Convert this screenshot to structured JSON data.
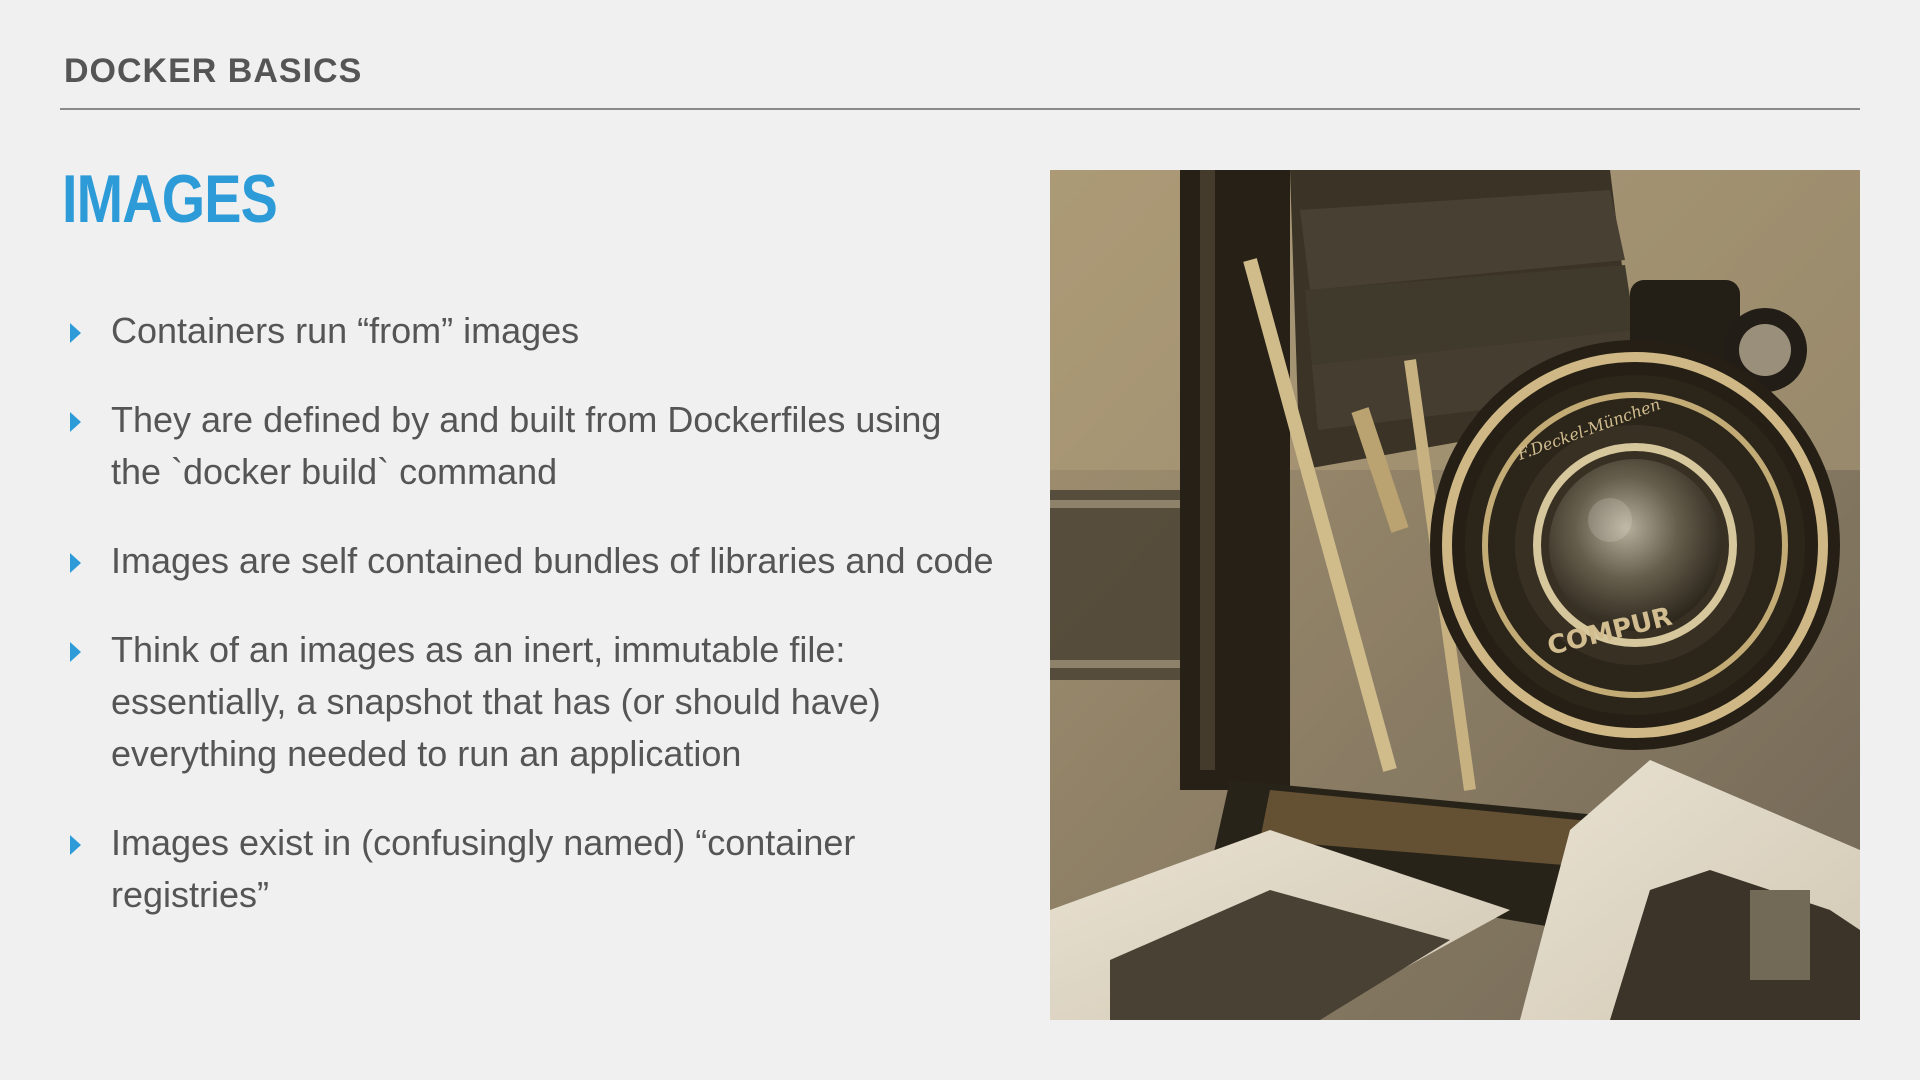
{
  "slide": {
    "section": "DOCKER BASICS",
    "title": "IMAGES",
    "bullets": [
      "Containers run “from” images",
      "They are defined by and built from Dockerfiles using the `docker build` command",
      "Images are self contained bundles of libraries and code",
      "Think of an images as an inert, immutable file: essentially, a snapshot that has (or should have) everything needed to run an application",
      "Images exist in (confusingly named) “container registries”"
    ]
  },
  "photo": {
    "lens_text": "F.Deckel-München",
    "shutter_text": "COMPUR"
  },
  "colors": {
    "accent": "#2d9bd8",
    "text": "#555555",
    "background": "#f0f0f0"
  }
}
